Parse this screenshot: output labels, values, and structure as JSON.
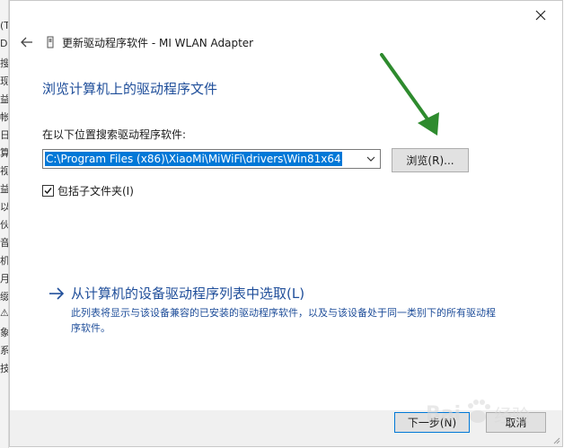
{
  "background_window": {
    "edge_chars": [
      "(T",
      "DE",
      "搜",
      "现",
      "益",
      "帐",
      "日",
      "算",
      "视",
      "益",
      "以",
      "伙",
      "音",
      "机",
      "月",
      "缀",
      "⚠",
      "象",
      "系",
      "技"
    ]
  },
  "dialog": {
    "header_title": "更新驱动程序软件 - MI WLAN Adapter",
    "section_title": "浏览计算机上的驱动程序文件",
    "search_label": "在以下位置搜索驱动程序软件:",
    "path_value": "C:\\Program Files (x86)\\XiaoMi\\MiWiFi\\drivers\\Win81x64",
    "browse_label": "浏览(R)...",
    "include_subfolders_label": "包括子文件夹(I)",
    "include_subfolders_checked": true,
    "pick_link_text": "从计算机的设备驱动程序列表中选取(L)",
    "pick_link_description": "此列表将显示与该设备兼容的已安装的驱动程序软件，以及与该设备处于同一类别下的所有驱动程序软件。",
    "next_label": "下一步(N)",
    "cancel_label": "取消"
  },
  "colors": {
    "accent_blue": "#1f4e9a",
    "selection_blue": "#0078d7",
    "annotation_green": "#2e8b2e"
  },
  "watermark": {
    "text": "Bai 经验"
  }
}
